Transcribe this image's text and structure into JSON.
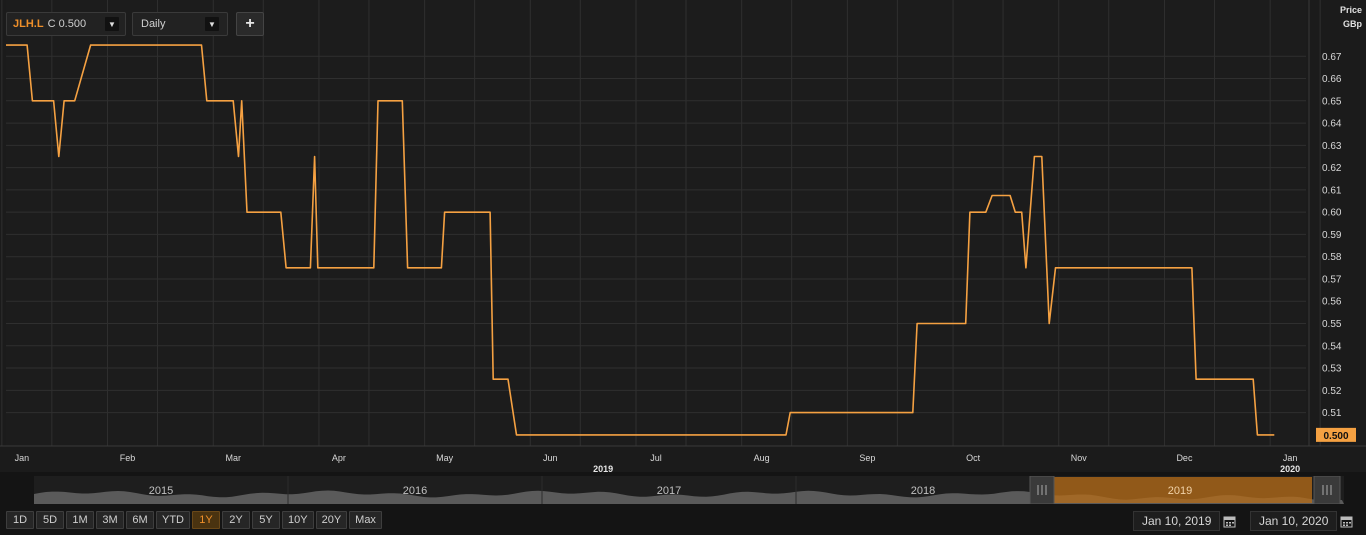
{
  "toolbar": {
    "symbol": "JLH.L",
    "close_label": "C 0.500",
    "interval": "Daily",
    "add_label": "+"
  },
  "axis": {
    "price_label": "Price",
    "currency_label": "GBp"
  },
  "last_value_label": "0.500",
  "colors": {
    "line": "#f5a142",
    "badge": "#f5a142",
    "grid": "#2f2f2f"
  },
  "chart_data": {
    "type": "line",
    "title": "",
    "xlabel": "",
    "ylabel": "Price GBp",
    "ylim": [
      0.495,
      0.68
    ],
    "xlim": [
      -0.15,
      12.15
    ],
    "yticks": [
      0.51,
      0.52,
      0.53,
      0.54,
      0.55,
      0.56,
      0.57,
      0.58,
      0.59,
      0.6,
      0.61,
      0.62,
      0.63,
      0.64,
      0.65,
      0.66,
      0.67
    ],
    "grid": true,
    "month_labels": [
      "Jan",
      "Feb",
      "Mar",
      "Apr",
      "May",
      "Jun",
      "Jul",
      "Aug",
      "Sep",
      "Oct",
      "Nov",
      "Dec",
      "Jan"
    ],
    "year_labels": [
      {
        "label": "2019",
        "month_index": 5.5
      },
      {
        "label": "2020",
        "month_index": 12
      }
    ],
    "series": [
      {
        "x": [
          -0.15,
          0.05,
          0.1,
          0.3,
          0.35,
          0.4,
          0.5,
          0.65,
          0.7,
          1.7,
          1.75,
          2.0,
          2.05,
          2.08,
          2.13,
          2.22,
          2.23,
          2.45,
          2.5,
          2.73,
          2.77,
          2.8,
          3.33,
          3.37,
          3.6,
          3.65,
          3.97,
          4.0,
          4.43,
          4.46,
          4.6,
          4.68,
          7.23,
          7.27,
          8.43,
          8.47,
          8.93,
          8.97,
          9.12,
          9.18,
          9.35,
          9.4,
          9.46,
          9.5,
          9.58,
          9.65,
          9.72,
          9.78,
          9.8,
          11.07,
          11.11,
          11.65,
          11.69,
          11.85
        ],
        "y": [
          0.675,
          0.675,
          0.65,
          0.65,
          0.625,
          0.65,
          0.65,
          0.675,
          0.675,
          0.675,
          0.65,
          0.65,
          0.625,
          0.65,
          0.6,
          0.6,
          0.6,
          0.6,
          0.575,
          0.575,
          0.625,
          0.575,
          0.575,
          0.65,
          0.65,
          0.575,
          0.575,
          0.6,
          0.6,
          0.525,
          0.525,
          0.5,
          0.5,
          0.51,
          0.51,
          0.55,
          0.55,
          0.6,
          0.6,
          0.6075,
          0.6075,
          0.6,
          0.6,
          0.575,
          0.625,
          0.625,
          0.55,
          0.575,
          0.575,
          0.575,
          0.525,
          0.525,
          0.5,
          0.5
        ]
      }
    ],
    "navigator": {
      "year_labels": [
        "2015",
        "2016",
        "2017",
        "2018",
        "2019"
      ],
      "selected_label": "2019"
    }
  },
  "range_buttons": [
    "1D",
    "5D",
    "1M",
    "3M",
    "6M",
    "YTD",
    "1Y",
    "2Y",
    "5Y",
    "10Y",
    "20Y",
    "Max"
  ],
  "active_range": "1Y",
  "date_from": "Jan 10, 2019",
  "date_to": "Jan 10, 2020"
}
